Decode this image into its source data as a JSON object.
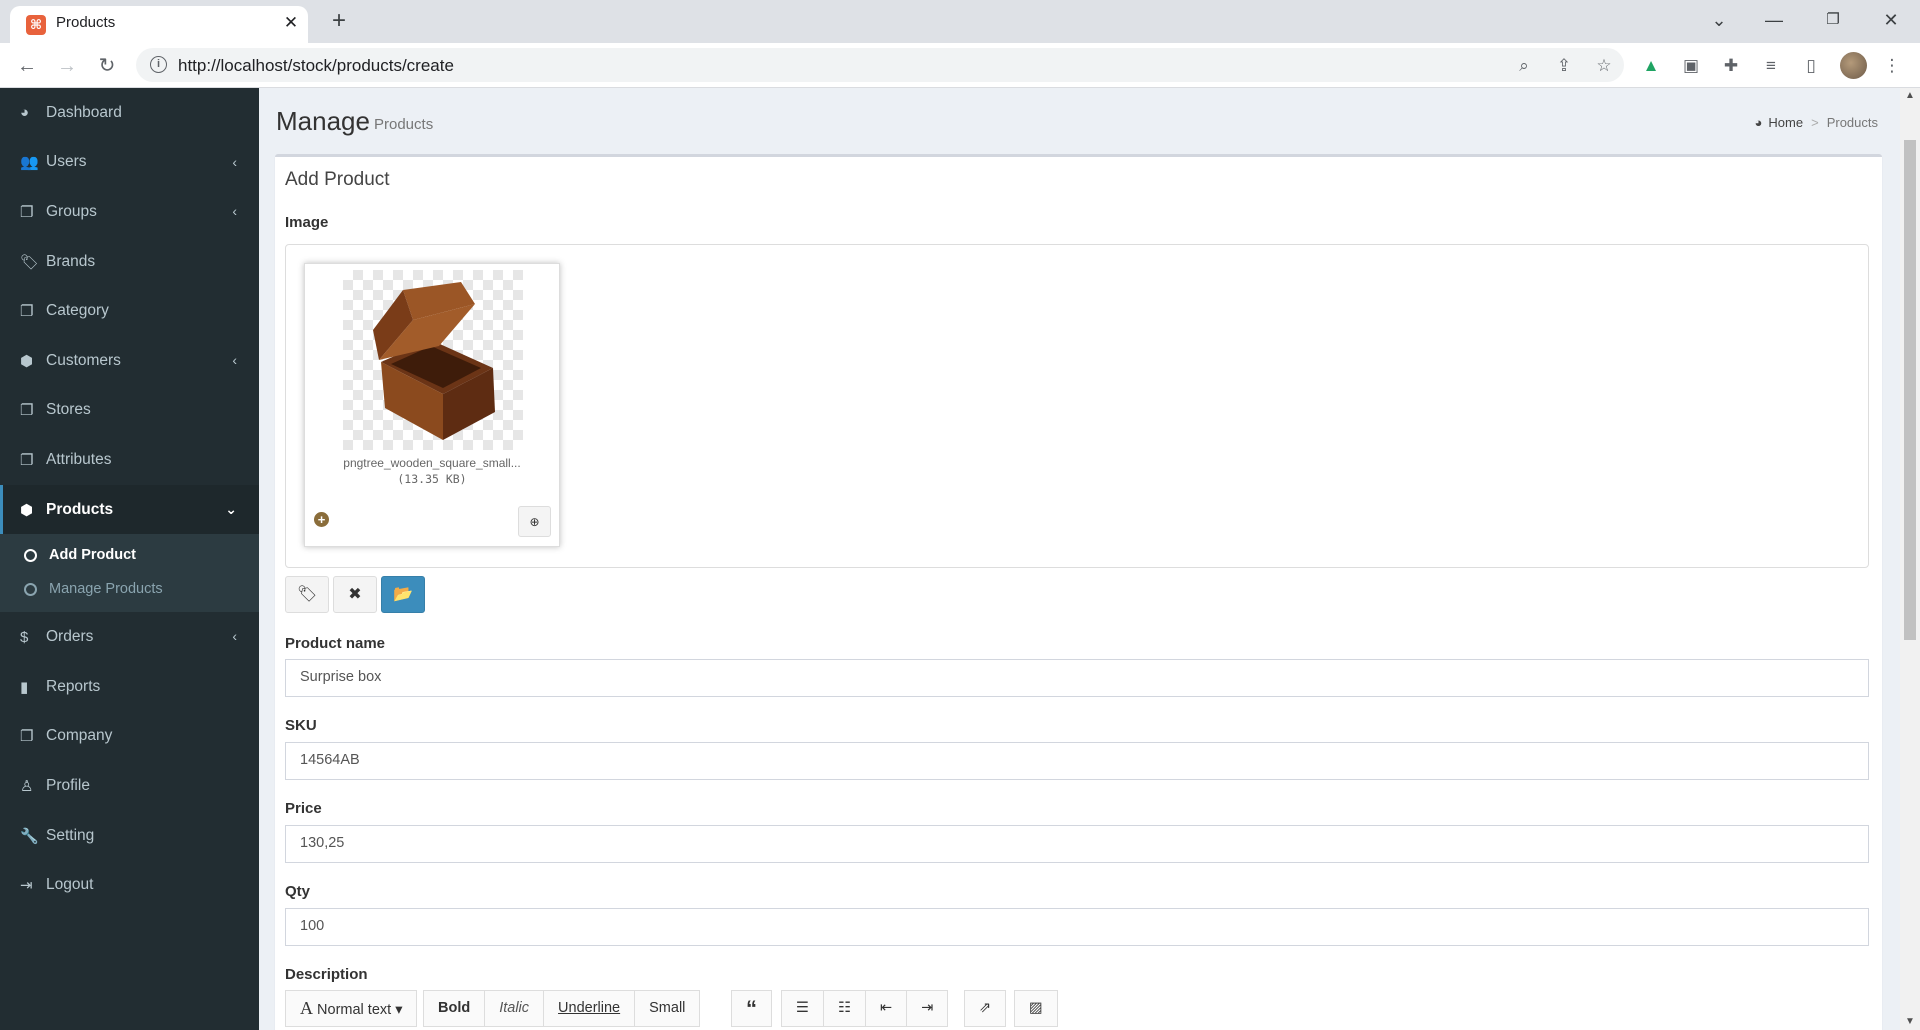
{
  "browser": {
    "tab_title": "Products",
    "tab_favicon": "stock-app-favicon",
    "url": "http://localhost/stock/products/create",
    "extension_icons": [
      "google-drive-icon",
      "extension-square-icon",
      "puzzle-icon",
      "reading-list-icon",
      "side-panel-icon"
    ]
  },
  "sidebar": {
    "items": [
      {
        "label": "Dashboard",
        "icon": "dashboard-icon",
        "has_children": false
      },
      {
        "label": "Users",
        "icon": "users-icon",
        "has_children": true
      },
      {
        "label": "Groups",
        "icon": "files-icon",
        "has_children": true
      },
      {
        "label": "Brands",
        "icon": "tags-icon",
        "has_children": false
      },
      {
        "label": "Category",
        "icon": "files-icon",
        "has_children": false
      },
      {
        "label": "Customers",
        "icon": "cube-icon",
        "has_children": true
      },
      {
        "label": "Stores",
        "icon": "files-icon",
        "has_children": false
      },
      {
        "label": "Attributes",
        "icon": "files-icon",
        "has_children": false
      },
      {
        "label": "Products",
        "icon": "cube-icon",
        "has_children": true,
        "expanded": true
      },
      {
        "label": "Orders",
        "icon": "dollar-icon",
        "has_children": true
      },
      {
        "label": "Reports",
        "icon": "bar-chart-icon",
        "has_children": false
      },
      {
        "label": "Company",
        "icon": "files-icon",
        "has_children": false
      },
      {
        "label": "Profile",
        "icon": "user-icon",
        "has_children": false
      },
      {
        "label": "Setting",
        "icon": "wrench-icon",
        "has_children": false
      },
      {
        "label": "Logout",
        "icon": "sign-out-icon",
        "has_children": false
      }
    ],
    "products_submenu": [
      {
        "label": "Add Product",
        "active": true
      },
      {
        "label": "Manage Products",
        "active": false
      }
    ]
  },
  "header": {
    "title": "Manage",
    "subtitle": "Products",
    "breadcrumb_home": "Home",
    "breadcrumb_current": "Products"
  },
  "form": {
    "box_title": "Add Product",
    "image_label": "Image",
    "image_file_name": "pngtree_wooden_square_small...",
    "image_file_size": "(13.35 KB)",
    "product_name_label": "Product name",
    "product_name_value": "Surprise box",
    "sku_label": "SKU",
    "sku_value": "14564AB",
    "price_label": "Price",
    "price_value": "130,25",
    "qty_label": "Qty",
    "qty_value": "100",
    "description_label": "Description",
    "editor": {
      "font_style": "Normal text",
      "bold": "Bold",
      "italic": "Italic",
      "underline": "Underline",
      "small": "Small"
    }
  },
  "colors": {
    "sidebar_bg": "#222d32",
    "accent": "#3c8dbc",
    "content_bg": "#ecf0f5"
  }
}
